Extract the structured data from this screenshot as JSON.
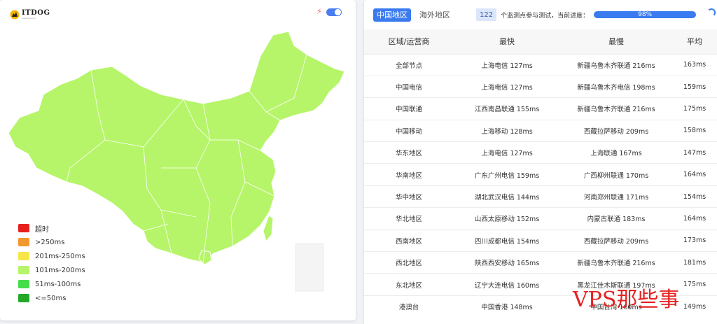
{
  "logo": {
    "title": "ITDOG",
    "subtitle": "www.itdog.cn"
  },
  "map": {
    "fill_color": "#b6f56a",
    "border_color": "#ffffff",
    "legend": [
      {
        "label": "超时",
        "color": "#e8201d"
      },
      {
        "label": ">250ms",
        "color": "#f2992e"
      },
      {
        "label": "201ms-250ms",
        "color": "#f7e54a"
      },
      {
        "label": "101ms-200ms",
        "color": "#b6f56a"
      },
      {
        "label": "51ms-100ms",
        "color": "#42dd47"
      },
      {
        "label": "<=50ms",
        "color": "#25a827"
      }
    ]
  },
  "tabs": {
    "active": "中国地区",
    "inactive": "海外地区"
  },
  "progress": {
    "count": "122",
    "text": "个监测点参与测试，当前进度：",
    "percent_label": "98%",
    "percent": 98
  },
  "table": {
    "headers": [
      "区域/运营商",
      "最快",
      "最慢",
      "平均"
    ],
    "rows": [
      [
        "全部节点",
        "上海电信 127ms",
        "新疆乌鲁木齐联通 216ms",
        "163ms"
      ],
      [
        "中国电信",
        "上海电信 127ms",
        "新疆乌鲁木齐电信 198ms",
        "159ms"
      ],
      [
        "中国联通",
        "江西南昌联通 155ms",
        "新疆乌鲁木齐联通 216ms",
        "175ms"
      ],
      [
        "中国移动",
        "上海移动 128ms",
        "西藏拉萨移动 209ms",
        "158ms"
      ],
      [
        "华东地区",
        "上海电信 127ms",
        "上海联通 167ms",
        "147ms"
      ],
      [
        "华南地区",
        "广东广州电信 159ms",
        "广西柳州联通 170ms",
        "164ms"
      ],
      [
        "华中地区",
        "湖北武汉电信 144ms",
        "河南郑州联通 171ms",
        "154ms"
      ],
      [
        "华北地区",
        "山西太原移动 152ms",
        "内蒙古联通 183ms",
        "164ms"
      ],
      [
        "西南地区",
        "四川成都电信 154ms",
        "西藏拉萨移动 209ms",
        "173ms"
      ],
      [
        "西北地区",
        "陕西西安移动 165ms",
        "新疆乌鲁木齐联通 216ms",
        "181ms"
      ],
      [
        "东北地区",
        "辽宁大连电信 160ms",
        "黑龙江佳木斯联通 197ms",
        "175ms"
      ],
      [
        "港澳台",
        "中国香港 148ms",
        "中国台湾 160ms",
        "149ms"
      ]
    ]
  },
  "watermark": "VPS那些事"
}
